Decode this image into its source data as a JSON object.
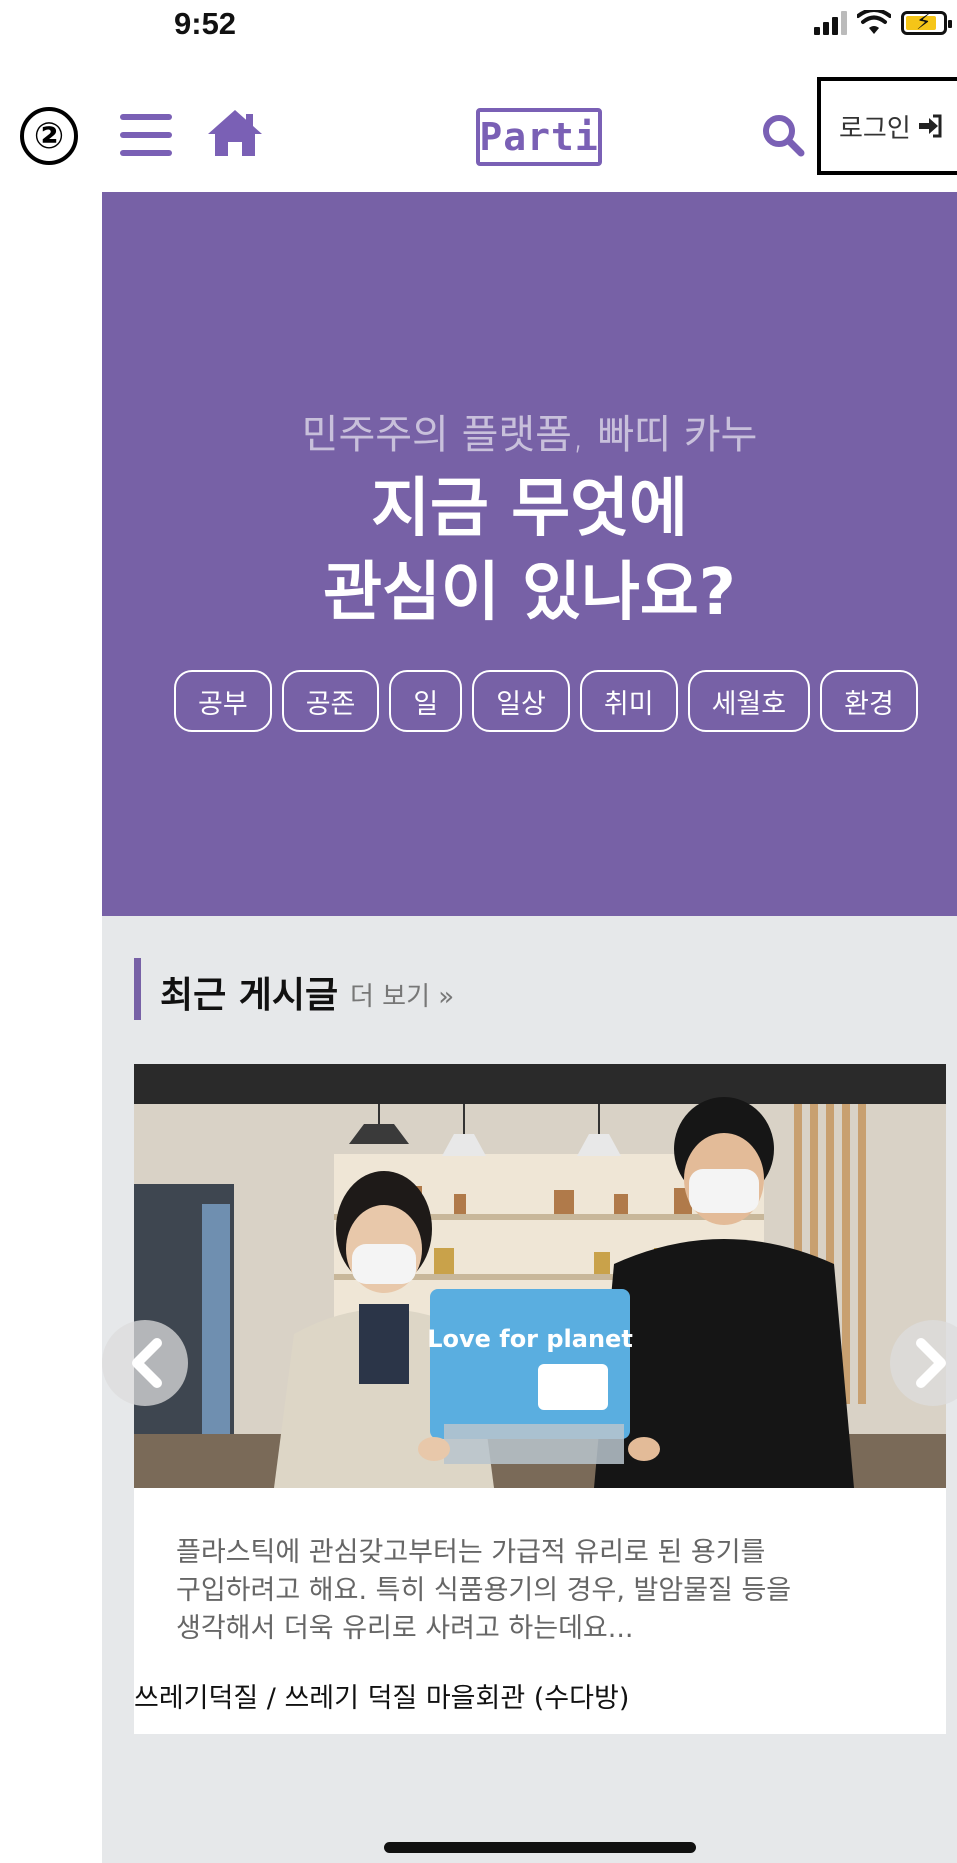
{
  "status_bar": {
    "time": "9:52"
  },
  "annotation": {
    "label": "②"
  },
  "header": {
    "logo_text": "Parti",
    "login_label": "로그인",
    "icons": {
      "menu": "hamburger-menu-icon",
      "home": "home-icon",
      "search": "search-icon",
      "login": "sign-in-icon"
    },
    "accent_color": "#7761a6"
  },
  "hero": {
    "subtitle": "민주주의 플랫폼, 빠띠 카누",
    "title_line1": "지금 무엇에",
    "title_line2": "관심이 있나요?",
    "tags": [
      "공부",
      "공존",
      "일",
      "일상",
      "취미",
      "세월호",
      "환경"
    ],
    "background_color": "#7761a6"
  },
  "recent_posts": {
    "title": "최근 게시글",
    "more_label": "더 보기 »",
    "cards": [
      {
        "image_text": "Love for planet",
        "excerpt_line1": "플라스틱에 관심갖고부터는 가급적 유리로 된 용기를",
        "excerpt_line2": "구입하려고 해요.  특히 식품용기의 경우, 발암물질 등을",
        "excerpt_line3": "생각해서 더욱 유리로 사려고 하는데요...",
        "meta": "쓰레기덕질 / 쓰레기 덕질 마을회관 (수다방)"
      }
    ]
  }
}
